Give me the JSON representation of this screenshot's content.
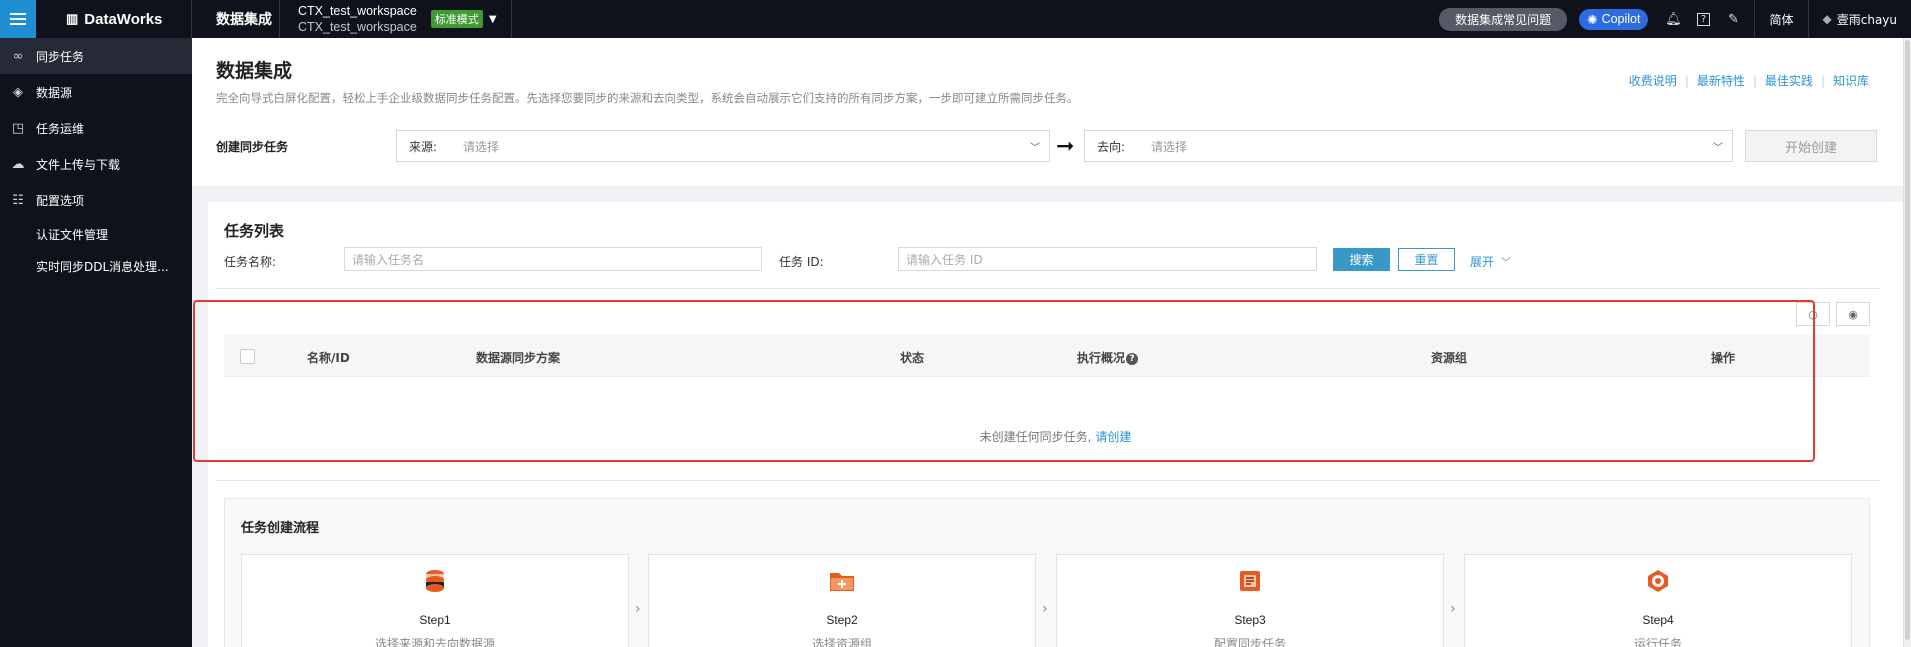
{
  "topbar": {
    "brand": "DataWorks",
    "product": "数据集成",
    "workspace_name": "CTX_test_workspace",
    "workspace_id": "CTX_test_workspace",
    "mode_badge": "标准模式",
    "faq": "数据集成常见问题",
    "copilot": "Copilot",
    "language": "简体",
    "user": "壹雨chayu"
  },
  "sidebar": {
    "items": [
      {
        "label": "同步任务",
        "icon": "sync-task-icon"
      },
      {
        "label": "数据源",
        "icon": "layers-icon"
      },
      {
        "label": "任务运维",
        "icon": "chart-icon"
      },
      {
        "label": "文件上传与下载",
        "icon": "cloud-upload-icon"
      },
      {
        "label": "配置选项",
        "icon": "checklist-icon"
      }
    ],
    "subitems": [
      "认证文件管理",
      "实时同步DDL消息处理..."
    ]
  },
  "header": {
    "title": "数据集成",
    "description": "完全向导式白屏化配置，轻松上手企业级数据同步任务配置。先选择您要同步的来源和去向类型，系统会自动展示它们支持的所有同步方案，一步即可建立所需同步任务。",
    "links": [
      "收费说明",
      "最新特性",
      "最佳实践",
      "知识库"
    ]
  },
  "create": {
    "label": "创建同步任务",
    "source_label": "来源:",
    "source_placeholder": "请选择",
    "target_label": "去向:",
    "target_placeholder": "请选择",
    "start_button": "开始创建"
  },
  "task_list": {
    "title": "任务列表",
    "name_label": "任务名称:",
    "name_placeholder": "请输入任务名",
    "id_label": "任务 ID:",
    "id_placeholder": "请输入任务 ID",
    "search": "搜索",
    "reset": "重置",
    "expand": "展开",
    "columns": [
      "名称/ID",
      "数据源同步方案",
      "状态",
      "执行概况",
      "资源组",
      "操作"
    ],
    "empty_text": "未创建任何同步任务,",
    "empty_link": "请创建"
  },
  "flow": {
    "title": "任务创建流程",
    "steps": [
      {
        "name": "Step1",
        "desc": "选择来源和去向数据源"
      },
      {
        "name": "Step2",
        "desc": "选择资源组"
      },
      {
        "name": "Step3",
        "desc": "配置同步任务"
      },
      {
        "name": "Step4",
        "desc": "运行任务"
      }
    ]
  },
  "colors": {
    "accent": "#2c95d8",
    "topbar": "#0f121a",
    "mode_badge": "#3f9a35",
    "copilot": "#2d6be0",
    "highlight": "#e53935"
  }
}
